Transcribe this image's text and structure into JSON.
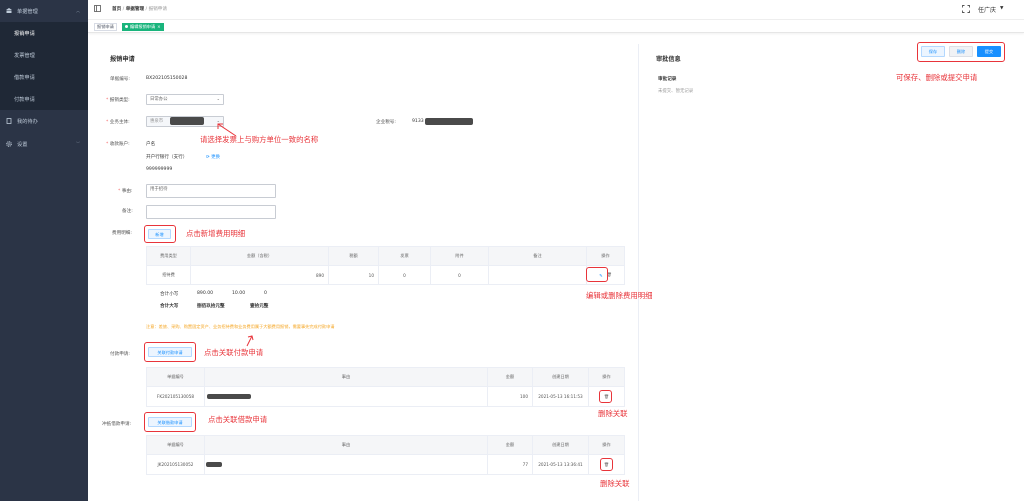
{
  "sidebar": {
    "groups": [
      {
        "label": "单据管理",
        "icon": "bank-icon"
      },
      {
        "label": "我的待办",
        "icon": "document-icon"
      },
      {
        "label": "设置",
        "icon": "gear-icon"
      }
    ],
    "sub_items": [
      "报销申请",
      "发票管理",
      "借款申请",
      "付款申请"
    ]
  },
  "topbar": {
    "breadcrumb": [
      "首页",
      "单据管理",
      "报销申请"
    ],
    "user": "任广庆"
  },
  "tags": [
    "报销申请",
    "编辑报销申请"
  ],
  "form": {
    "title": "报销申请",
    "doc_no_label": "单据编号:",
    "doc_no": "BX202105150028",
    "type_label": "报销类型:",
    "type_value": "日常办公",
    "entity_label": "业务主体:",
    "entity_value": "惠泉市",
    "tax_label": "企业税号:",
    "tax_value": "9133",
    "payee_label": "收款账户:",
    "payee_name": "户名",
    "bank_label": "开户行银行（支行）",
    "change_link": "更换",
    "account_no": "999999999",
    "reason_label": "事由:",
    "reason_placeholder": "用于招待",
    "remark_label": "备注:",
    "fee_label": "费用明细:",
    "add_btn": "新增",
    "fee_table": {
      "headers": [
        "费用类型",
        "金额（含税）",
        "税额",
        "发票",
        "附件",
        "备注",
        "操作"
      ],
      "row": [
        "招待费",
        "890",
        "10",
        "0",
        "0",
        ""
      ]
    },
    "total_small_label": "合计小写",
    "total_small_amount": "890.00",
    "total_small_tax": "10.00",
    "total_small_other": "0",
    "total_big_label": "合计大写",
    "total_big_amount": "捌佰玖拾元整",
    "total_big_tax": "壹拾元整",
    "notice": "注意：差旅、采购、购置固定资产、业务招待费和业务费用属于大额费用报销，需要事先完成付款申请",
    "pay_label": "付款申请:",
    "pay_btn": "关联付款申请",
    "pay_table": {
      "headers": [
        "单据编号",
        "事由",
        "金额",
        "创建日期",
        "操作"
      ],
      "row": [
        "FK202105130058",
        "",
        "100",
        "2021-05-13 16:11:53"
      ]
    },
    "loan_label": "冲抵借款申请:",
    "loan_btn": "关联借款申请",
    "loan_table": {
      "headers": [
        "单据编号",
        "事由",
        "金额",
        "创建日期",
        "操作"
      ],
      "row": [
        "JK202105130052",
        "",
        "77",
        "2021-05-13 13:36:41"
      ]
    }
  },
  "approval": {
    "title": "审批信息",
    "record_label": "审批记录",
    "record_empty": "未提交、暂无记录"
  },
  "actions": {
    "save": "保存",
    "delete": "删除",
    "submit": "提交"
  },
  "annotations": {
    "save_tip": "可保存、删除或提交申请",
    "name_tip": "请选择发票上与购方单位一致的名称",
    "add_tip": "点击新增费用明细",
    "edit_tip": "编辑或删除费用明细",
    "pay_tip": "点击关联付款申请",
    "loan_tip": "点击关联借款申请",
    "unlink_tip_1": "删除关联",
    "unlink_tip_2": "删除关联"
  },
  "colors": {
    "sidebar": "#2b3446",
    "accent": "#1890ff",
    "tag_active": "#19b47c",
    "annotation": "#e8343a",
    "notice": "#f5a623"
  }
}
